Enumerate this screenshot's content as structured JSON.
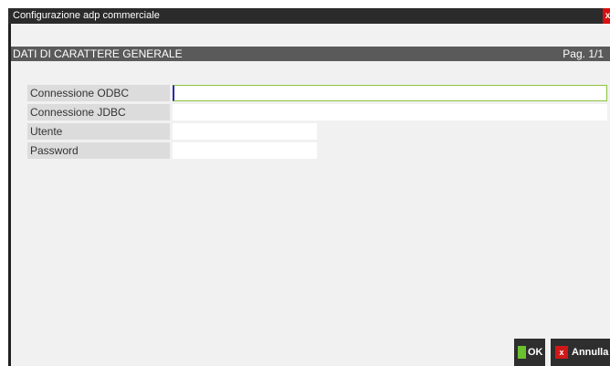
{
  "window": {
    "title": "Configurazione adp commerciale",
    "close_label": "x"
  },
  "section": {
    "title": "DATI DI CARATTERE GENERALE",
    "page": "Pag. 1/1"
  },
  "fields": [
    {
      "label": "Connessione ODBC",
      "value": ""
    },
    {
      "label": "Connessione JDBC",
      "value": ""
    },
    {
      "label": "Utente",
      "value": ""
    },
    {
      "label": "Password",
      "value": ""
    }
  ],
  "buttons": {
    "ok_label": "OK",
    "cancel_label": "Annulla",
    "cancel_icon": "x"
  },
  "colors": {
    "titlebar": "#2b2b2b",
    "close": "#d81010",
    "header": "#5a5a5a",
    "label_bg": "#dcdcdc",
    "focus_border": "#8cc43c",
    "ok_icon": "#6bc130"
  }
}
